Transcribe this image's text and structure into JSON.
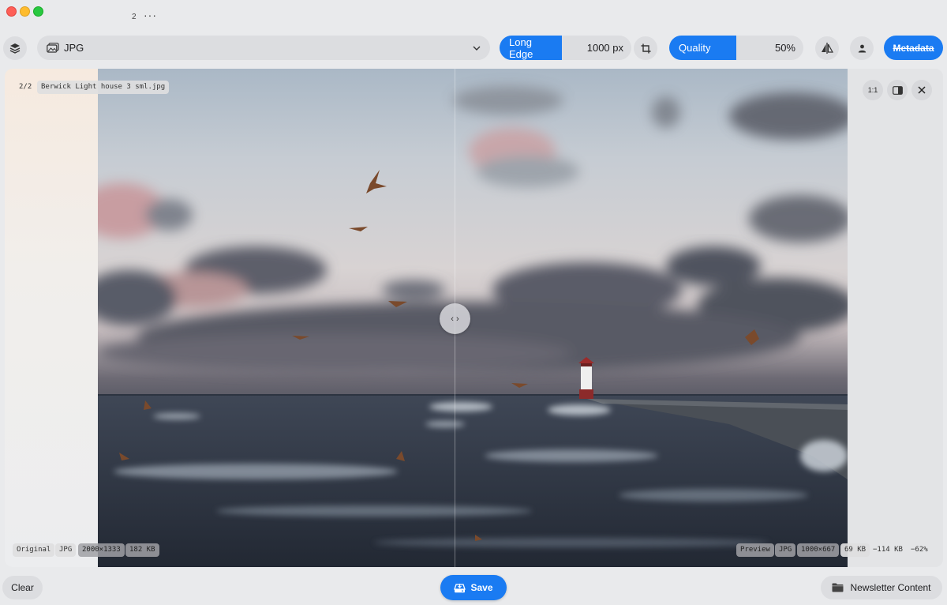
{
  "window": {
    "image_count": "2",
    "more_label": "···"
  },
  "toolbar": {
    "format_label": "JPG",
    "resize_mode_label": "Long Edge",
    "resize_value": "1000 px",
    "quality_label": "Quality",
    "quality_value": "50%",
    "metadata_label": "Metadata"
  },
  "image_info": {
    "index": "2/2",
    "filename": "Berwick Light house 3 sml.jpg"
  },
  "zoom": {
    "actual_size_label": "1:1"
  },
  "split_handle_label": "‹ ›",
  "original": {
    "label": "Original",
    "format": "JPG",
    "dimensions": "2000×1333",
    "size": "182 KB"
  },
  "preview": {
    "label": "Preview",
    "format": "JPG",
    "dimensions": "1000×667",
    "size": "69 KB",
    "size_diff": "−114 KB",
    "percent_diff": "−62%"
  },
  "bottom": {
    "clear_label": "Clear",
    "save_label": "Save",
    "folder_label": "Newsletter Content"
  },
  "colors": {
    "accent": "#1a7bf2",
    "chrome_bg": "#e9eaec",
    "control_bg": "#dcdde0"
  },
  "icons": {
    "layers": "layers-icon",
    "format": "image-stack-icon",
    "crop": "crop-icon",
    "compare": "compare-icon",
    "person": "person-icon",
    "sidebar": "sidebar-toggle-icon",
    "close": "close-icon",
    "save": "save-drive-icon",
    "folder": "folder-icon"
  }
}
